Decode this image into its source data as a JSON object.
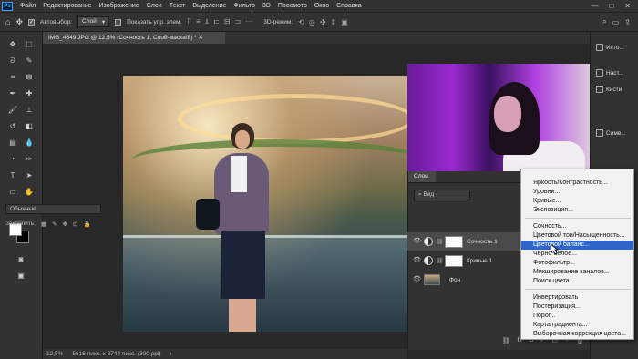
{
  "app": {
    "logo": "Ps"
  },
  "menu": [
    "Файл",
    "Редактирование",
    "Изображение",
    "Слои",
    "Текст",
    "Выделение",
    "Фильтр",
    "3D",
    "Просмотр",
    "Окно",
    "Справка"
  ],
  "window_controls": [
    "—",
    "□",
    "✕"
  ],
  "options_bar": {
    "autoselect_label": "Автовыбор:",
    "autoselect_value": "Слой",
    "show_controls_label": "Показать упр. элем.",
    "mode_3d_label": "3D-режим:"
  },
  "document": {
    "tab_title": "IMG_4849.JPG @ 12,5% (Сочность 1, Слой-маска/8) *",
    "zoom": "12,5%",
    "info": "5616 пикс. x 3744 пикс. (300 ppi)"
  },
  "right_panel": {
    "items": [
      {
        "label": "Исто..."
      },
      {
        "label": "Наст..."
      },
      {
        "label": "Кисти"
      },
      {
        "label": "Симв..."
      }
    ]
  },
  "layers_panel": {
    "tab_label": "Слои",
    "filter_placeholder": "Вид",
    "blend_mode": "Обычные",
    "lock_label": "Закрепить:",
    "layers": [
      {
        "name": "Сочность 1",
        "type": "adjustment",
        "selected": true
      },
      {
        "name": "Кривые 1",
        "type": "adjustment",
        "selected": false
      },
      {
        "name": "Фон",
        "type": "photo",
        "selected": false
      }
    ],
    "bottom_icons": [
      "link-icon",
      "fx-icon",
      "mask-icon",
      "adjustment-icon",
      "folder-icon",
      "new-layer-icon",
      "trash-icon"
    ],
    "bottom_glyphs": [
      "⛓",
      "fx",
      "◘",
      "◐",
      "▭",
      "+",
      "🗑"
    ]
  },
  "context_menu": {
    "groups": [
      [
        "Яркость/Контрастность...",
        "Уровни...",
        "Кривые...",
        "Экспозиция..."
      ],
      [
        "Сочность...",
        "Цветовой тон/Насыщенность...",
        "Цветовой баланс...",
        "Черно-белое...",
        "Фотофильтр...",
        "Микширование каналов...",
        "Поиск цвета..."
      ],
      [
        "Инвертировать",
        "Постеризация...",
        "Порог...",
        "Карта градиента...",
        "Выборочная коррекция цвета..."
      ]
    ],
    "highlighted": "Цветовой баланс..."
  }
}
